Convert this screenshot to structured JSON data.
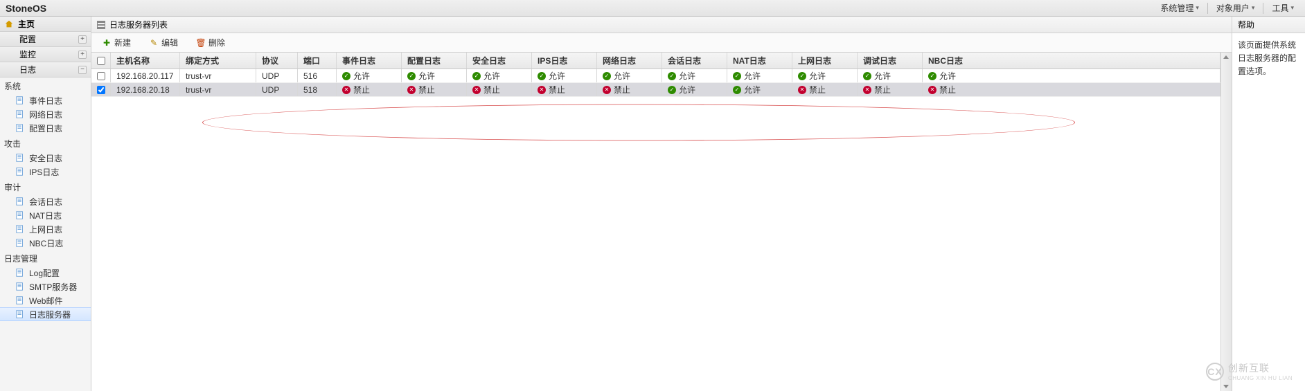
{
  "brand": "StoneOS",
  "topmenu": {
    "system": "系统管理",
    "object": "对象用户",
    "tools": "工具"
  },
  "sidebar": {
    "home": "主页",
    "config": "配置",
    "monitor": "监控",
    "log": "日志",
    "groups": [
      {
        "title": "系统",
        "items": [
          {
            "label": "事件日志"
          },
          {
            "label": "网络日志"
          },
          {
            "label": "配置日志"
          }
        ]
      },
      {
        "title": "攻击",
        "items": [
          {
            "label": "安全日志"
          },
          {
            "label": "IPS日志"
          }
        ]
      },
      {
        "title": "审计",
        "items": [
          {
            "label": "会话日志"
          },
          {
            "label": "NAT日志"
          },
          {
            "label": "上网日志"
          },
          {
            "label": "NBC日志"
          }
        ]
      },
      {
        "title": "日志管理",
        "items": [
          {
            "label": "Log配置"
          },
          {
            "label": "SMTP服务器"
          },
          {
            "label": "Web邮件"
          },
          {
            "label": "日志服务器",
            "selected": true
          }
        ]
      }
    ]
  },
  "panel": {
    "title": "日志服务器列表",
    "toolbar": {
      "new": "新建",
      "edit": "编辑",
      "delete": "删除"
    },
    "columns": {
      "host": "主机名称",
      "bind": "绑定方式",
      "proto": "协议",
      "port": "端口",
      "event": "事件日志",
      "config": "配置日志",
      "security": "安全日志",
      "ips": "IPS日志",
      "network": "网络日志",
      "session": "会话日志",
      "nat": "NAT日志",
      "web": "上网日志",
      "debug": "调试日志",
      "nbc": "NBC日志"
    },
    "status_labels": {
      "allow": "允许",
      "deny": "禁止"
    },
    "rows": [
      {
        "checked": false,
        "host": "192.168.20.117",
        "bind": "trust-vr",
        "proto": "UDP",
        "port": "516",
        "event": "allow",
        "config": "allow",
        "security": "allow",
        "ips": "allow",
        "network": "allow",
        "session": "allow",
        "nat": "allow",
        "web": "allow",
        "debug": "allow",
        "nbc": "allow"
      },
      {
        "checked": true,
        "host": "192.168.20.18",
        "bind": "trust-vr",
        "proto": "UDP",
        "port": "518",
        "event": "deny",
        "config": "deny",
        "security": "deny",
        "ips": "deny",
        "network": "deny",
        "session": "allow",
        "nat": "allow",
        "web": "deny",
        "debug": "deny",
        "nbc": "deny"
      }
    ]
  },
  "help": {
    "title": "帮助",
    "body": "该页面提供系统日志服务器的配置选项。"
  },
  "watermark": {
    "cn": "创新互联",
    "en": "CHUANG XIN HU LIAN",
    "mono": "CX"
  }
}
